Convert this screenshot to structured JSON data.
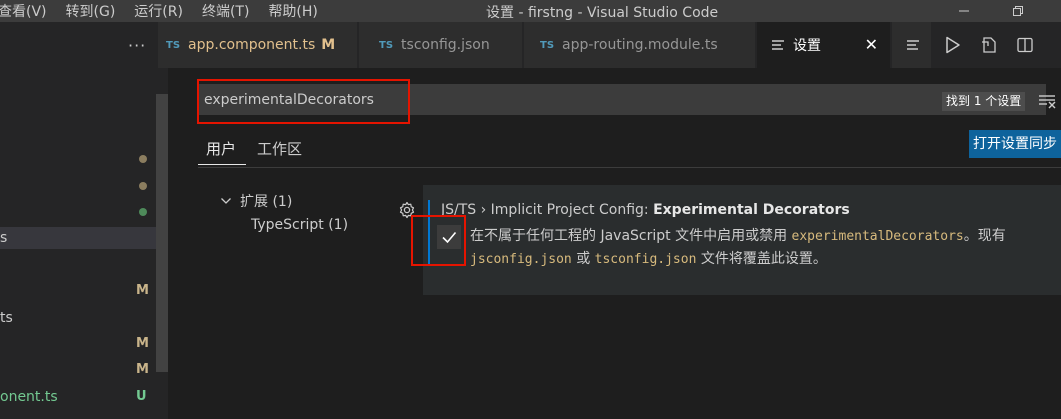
{
  "titlebar": {
    "menu": [
      "查看(V)",
      "转到(G)",
      "运行(R)",
      "终端(T)",
      "帮助(H)"
    ],
    "title": "设置 - firstng - Visual Studio Code",
    "controls": [
      "minimize-icon",
      "restore-icon"
    ]
  },
  "sidebar": {
    "more": "···",
    "rows": [
      {
        "label": "s",
        "selected": true
      },
      {
        "label": "",
        "badge": "M"
      },
      {
        "label": "ts",
        "badge": ""
      },
      {
        "label": "",
        "badge": "M"
      },
      {
        "label": "",
        "badge": "M"
      },
      {
        "label": "onent.ts",
        "badge": "U"
      }
    ],
    "dot_colors": [
      "#8b7d5f",
      "#8b7d5f",
      "#4e8a5a"
    ]
  },
  "tabs": [
    {
      "icon": "TS",
      "name": "app.component.ts",
      "modified": "M"
    },
    {
      "icon": "TS",
      "name": "tsconfig.json"
    },
    {
      "icon": "TS",
      "name": "app-routing.module.ts"
    },
    {
      "icon": "settings-icon",
      "name": "设置",
      "close": "✕",
      "active": true
    }
  ],
  "editor_actions": [
    "split-icon",
    "run-icon",
    "open-changes-icon",
    "split-editor-icon"
  ],
  "settings": {
    "search_value": "experimentalDecorators",
    "found_label": "找到 1 个设置",
    "scope_tabs": [
      "用户",
      "工作区"
    ],
    "sync_button": "打开设置同步",
    "toc": {
      "group_label": "扩展 (1)",
      "child_label": "TypeScript (1)"
    },
    "item": {
      "category": "JS/TS › Implicit Project Config: ",
      "name": "Experimental Decorators",
      "checked": true,
      "desc_1": "在不属于任何工程的 JavaScript 文件中启用或禁用 ",
      "desc_code_1": "experimentalDecorators",
      "desc_2": "。现有",
      "desc_code_2": "jsconfig.json",
      "desc_3": " 或 ",
      "desc_code_3": "tsconfig.json",
      "desc_4": " 文件将覆盖此设置。"
    }
  },
  "colors": {
    "accent": "#0e639c",
    "highlight_border": "#e51400",
    "modified": "#e2c08d",
    "untracked": "#73c991"
  }
}
